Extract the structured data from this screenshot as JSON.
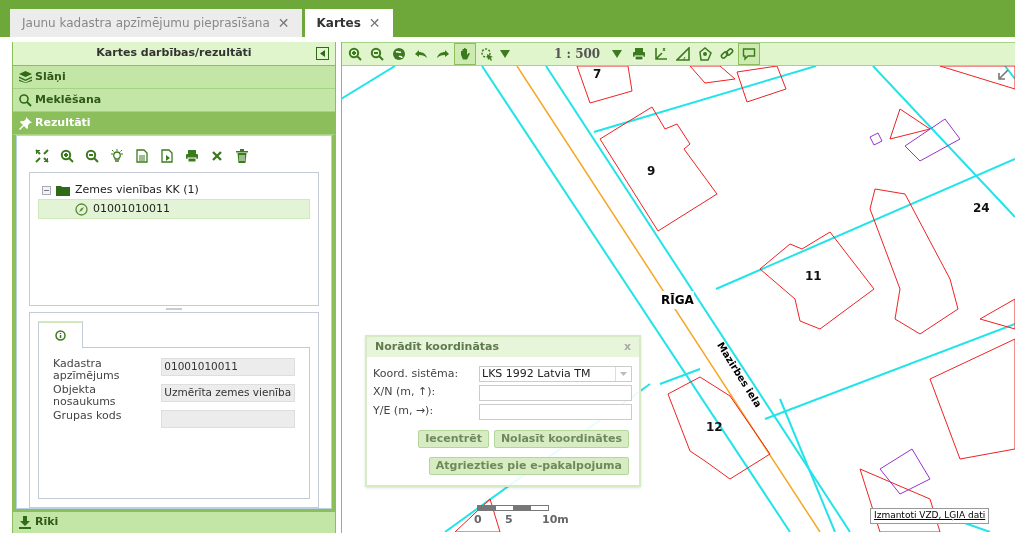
{
  "tabs": [
    {
      "label": "Jaunu kadastra apzīmējumu pieprasīšana",
      "close": "✕",
      "selected": false
    },
    {
      "label": "Kartes",
      "close": "✕",
      "selected": true
    }
  ],
  "panel": {
    "title": "Kartes darbības/rezultāti",
    "sections": [
      {
        "label": "Slāņi",
        "selected": false
      },
      {
        "label": "Meklēšana",
        "selected": false
      },
      {
        "label": "Rezultāti",
        "selected": true
      }
    ],
    "tree": {
      "label": "Zemes vienības KK (1)",
      "expanded": true,
      "children": [
        {
          "label": "01001010011",
          "selected": true
        }
      ]
    },
    "fields": [
      {
        "label": "Kadastra apzīmējums",
        "value": "01001010011"
      },
      {
        "label": "Objekta nosaukums",
        "value": "Uzmērīta zemes vienība"
      },
      {
        "label": "Grupas kods"
      }
    ],
    "footer_section": {
      "label": "Rīki",
      "selected": false
    }
  },
  "map_toolbar": {
    "tools": [
      {
        "selected": false
      },
      {
        "selected": false
      },
      {
        "selected": false
      },
      {
        "selected": false
      },
      {
        "selected": false
      },
      {
        "selected": true
      },
      {
        "selected": false
      }
    ],
    "scale": "1 : 500",
    "tools_right": [
      {
        "selected": false
      },
      {
        "selected": false
      },
      {
        "selected": false
      },
      {
        "selected": false
      },
      {
        "selected": false
      },
      {
        "selected": true
      }
    ]
  },
  "map_labels": [
    {
      "text": "7",
      "kind": "lot"
    },
    {
      "text": "9",
      "kind": "lot"
    },
    {
      "text": "24",
      "kind": "lot"
    },
    {
      "text": "11",
      "kind": "lot"
    },
    {
      "text": "RĪGA",
      "kind": "city"
    },
    {
      "text": "12",
      "kind": "lot"
    },
    {
      "text": "Mazirbes iela",
      "kind": "street"
    }
  ],
  "dialog": {
    "title": "Norādīt koordinātas",
    "close": "x",
    "coord_label": "Koord. sistēma:",
    "coord_value": "LKS 1992 Latvia TM",
    "inputs": [
      {
        "label": "X/N (m, ↑):"
      },
      {
        "label": "Y/E (m, →):"
      }
    ],
    "buttons": [
      "Iecentrēt",
      "Nolasīt koordinātes",
      "Atgriezties pie e-pakalpojuma"
    ]
  },
  "scale_bar": [
    "0",
    "5",
    "10m"
  ],
  "attribution": "Izmantoti VZD, LĢIA dati"
}
